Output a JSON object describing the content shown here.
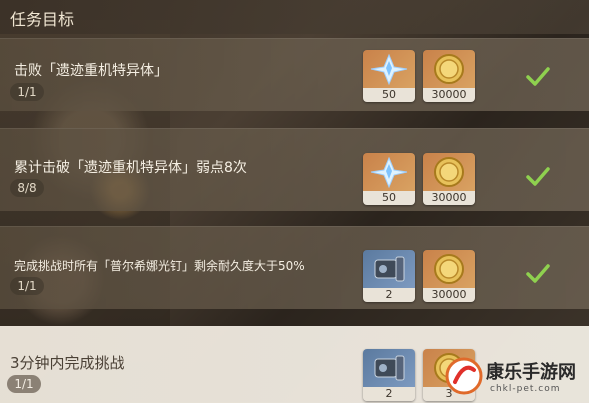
{
  "header": {
    "title": "任务目标"
  },
  "objectives": [
    {
      "text": "击败「遗迹重机特异体」",
      "progress": "1/1",
      "rewards": [
        "50",
        "30000"
      ],
      "completed": true
    },
    {
      "text": "累计击破「遗迹重机特异体」弱点8次",
      "progress": "8/8",
      "rewards": [
        "50",
        "30000"
      ],
      "completed": true
    },
    {
      "text": "完成挑战时所有「普尔希娜光钉」剩余耐久度大于50%",
      "progress": "1/1",
      "rewards": [
        "2",
        "30000"
      ],
      "completed": true
    },
    {
      "text": "3分钟内完成挑战",
      "progress": "1/1",
      "rewards": [
        "2",
        "3"
      ],
      "completed": false
    }
  ],
  "watermark": {
    "name": "康乐手游网",
    "url": "chkl-pet.com"
  },
  "colors": {
    "check": "#8fd14f",
    "orange_reward": "#d09050",
    "blue_reward": "#6b88ad"
  },
  "icons": [
    "primogem-icon",
    "mora-coin-icon",
    "hydraulic-tool-icon",
    "checkmark-icon"
  ]
}
